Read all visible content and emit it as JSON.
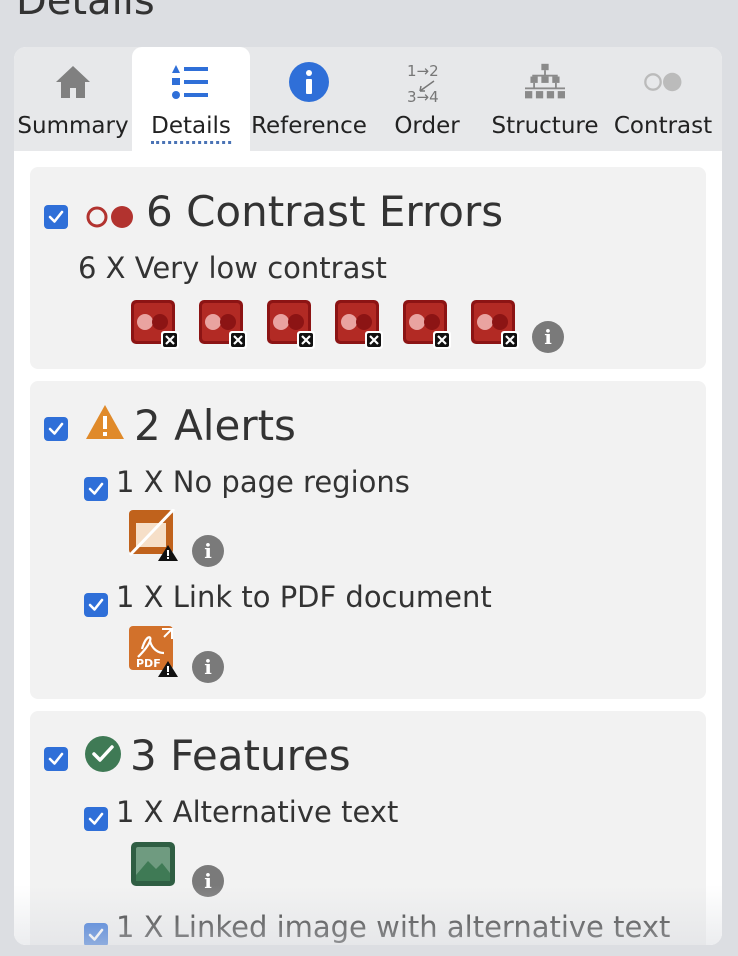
{
  "page": {
    "title": "Details"
  },
  "tabs": [
    {
      "label": "Summary",
      "icon": "home-icon"
    },
    {
      "label": "Details",
      "icon": "list-icon",
      "active": true
    },
    {
      "label": "Reference",
      "icon": "info-icon"
    },
    {
      "label": "Order",
      "icon": "order-icon",
      "order_glyph": "1→2\n3→4"
    },
    {
      "label": "Structure",
      "icon": "structure-icon"
    },
    {
      "label": "Contrast",
      "icon": "contrast-icon"
    }
  ],
  "contrast_section": {
    "title": "6 Contrast Errors",
    "checked": true,
    "item_label": "6 X Very low contrast",
    "item_count": 6,
    "color": "#b2332f"
  },
  "alerts_section": {
    "title": "2 Alerts",
    "checked": true,
    "color": "#e08a2a",
    "items": [
      {
        "label": "1 X No page regions",
        "checked": true,
        "icon": "no-regions-icon"
      },
      {
        "label": "1 X Link to PDF document",
        "checked": true,
        "icon": "pdf-link-icon",
        "icon_text": "PDF"
      }
    ]
  },
  "features_section": {
    "title": "3 Features",
    "checked": true,
    "color": "#3f7a55",
    "items": [
      {
        "label": "1 X Alternative text",
        "checked": true,
        "icon": "image-alt-icon"
      },
      {
        "label": "1 X Linked image with alternative text",
        "checked": true
      }
    ]
  },
  "info_badge_glyph": "i",
  "colors": {
    "accent": "#2f6fd8",
    "error": "#b2332f",
    "alert": "#e08a2a",
    "feature": "#3f7a55"
  }
}
